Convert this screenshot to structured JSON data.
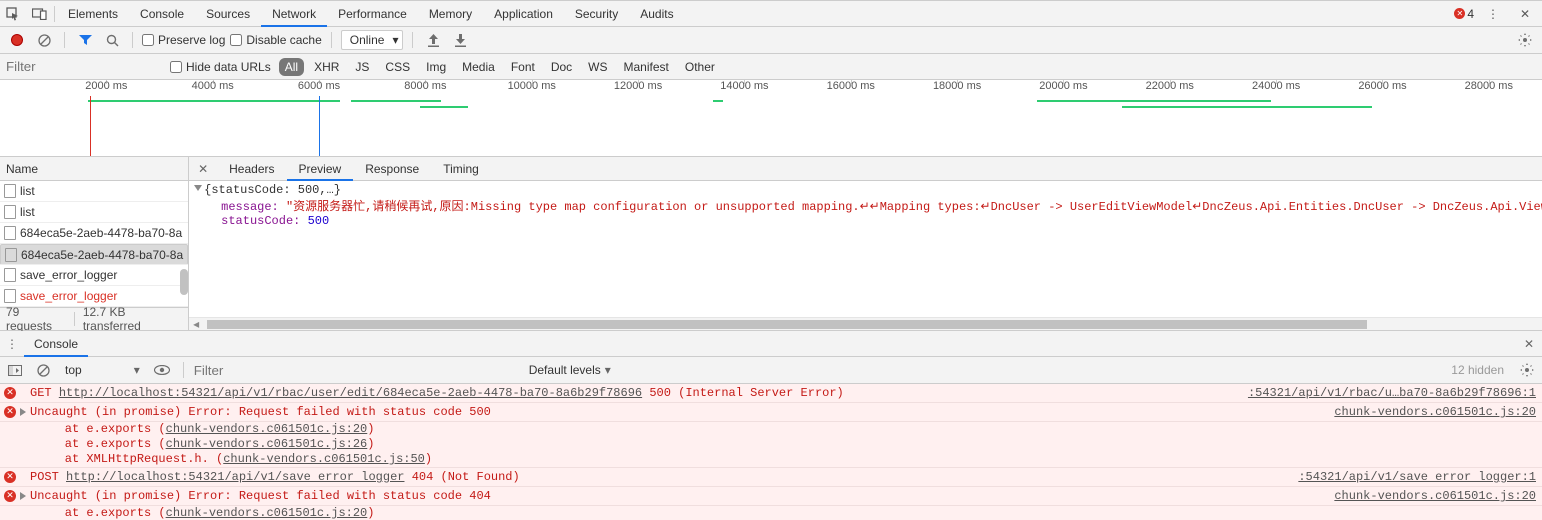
{
  "tabs": {
    "items": [
      "Elements",
      "Console",
      "Sources",
      "Network",
      "Performance",
      "Memory",
      "Application",
      "Security",
      "Audits"
    ],
    "active": "Network",
    "error_count": "4"
  },
  "toolbar": {
    "preserve_log": "Preserve log",
    "disable_cache": "Disable cache",
    "throttling": "Online"
  },
  "filter": {
    "placeholder": "Filter",
    "hide_data_urls": "Hide data URLs",
    "types": [
      "All",
      "XHR",
      "JS",
      "CSS",
      "Img",
      "Media",
      "Font",
      "Doc",
      "WS",
      "Manifest",
      "Other"
    ],
    "active_type": "All"
  },
  "timeline": {
    "labels": [
      "2000 ms",
      "4000 ms",
      "6000 ms",
      "8000 ms",
      "10000 ms",
      "12000 ms",
      "14000 ms",
      "16000 ms",
      "18000 ms",
      "20000 ms",
      "22000 ms",
      "24000 ms",
      "26000 ms",
      "28000 ms"
    ],
    "cursor_ms": 6000,
    "redline_ms": 1700,
    "bars": [
      {
        "from": 1650,
        "to": 6400,
        "row": 0
      },
      {
        "from": 6600,
        "to": 8300,
        "row": 0
      },
      {
        "from": 7900,
        "to": 8800,
        "row": 1
      },
      {
        "from": 13400,
        "to": 13600,
        "row": 0
      },
      {
        "from": 19500,
        "to": 23900,
        "row": 0
      },
      {
        "from": 21100,
        "to": 25800,
        "row": 1
      }
    ]
  },
  "requests": {
    "header": "Name",
    "items": [
      {
        "name": "list",
        "err": false,
        "sel": false
      },
      {
        "name": "list",
        "err": false,
        "sel": false
      },
      {
        "name": "684eca5e-2aeb-4478-ba70-8a",
        "err": false,
        "sel": false
      },
      {
        "name": "684eca5e-2aeb-4478-ba70-8a",
        "err": false,
        "sel": true
      },
      {
        "name": "save_error_logger",
        "err": false,
        "sel": false
      },
      {
        "name": "save_error_logger",
        "err": true,
        "sel": false
      }
    ],
    "status": {
      "count": "79 requests",
      "transfer": "12.7 KB transferred"
    }
  },
  "detail": {
    "tabs": [
      "Headers",
      "Preview",
      "Response",
      "Timing"
    ],
    "active": "Preview",
    "summary": "{statusCode: 500,…}",
    "message_key": "message:",
    "message_val": "\"资源服务器忙,请稍候再试,原因:Missing type map configuration or unsupported mapping.↵↵Mapping types:↵DncUser -> UserEditViewModel↵DncZeus.Api.Entities.DncUser -> DncZeus.Api.ViewModels.Rbac.DncUs",
    "status_key": "statusCode:",
    "status_val": "500"
  },
  "drawer": {
    "tab": "Console",
    "context": "top",
    "filter_placeholder": "Filter",
    "levels": "Default levels",
    "hidden": "12 hidden"
  },
  "console": [
    {
      "type": "err",
      "tri": false,
      "method": "GET",
      "url": "http://localhost:54321/api/v1/rbac/user/edit/684eca5e-2aeb-4478-ba70-8a6b29f78696",
      "status": "500 (Internal Server Error)",
      "src": ":54321/api/v1/rbac/u…ba70-8a6b29f78696:1"
    },
    {
      "type": "stackhead",
      "tri": true,
      "msg": "Uncaught (in promise) Error: Request failed with status code 500",
      "src": "chunk-vendors.c061501c.js:20"
    },
    {
      "type": "stack",
      "lines": [
        {
          "pre": "at e.exports (",
          "file": "chunk-vendors.c061501c.js:20",
          "post": ")"
        },
        {
          "pre": "at e.exports (",
          "file": "chunk-vendors.c061501c.js:26",
          "post": ")"
        },
        {
          "pre": "at XMLHttpRequest.h.<computed> (",
          "file": "chunk-vendors.c061501c.js:50",
          "post": ")"
        }
      ]
    },
    {
      "type": "err",
      "tri": false,
      "method": "POST",
      "url": "http://localhost:54321/api/v1/save error logger",
      "status": "404 (Not Found)",
      "src": ":54321/api/v1/save error logger:1"
    },
    {
      "type": "stackhead",
      "tri": true,
      "msg": "Uncaught (in promise) Error: Request failed with status code 404",
      "src": "chunk-vendors.c061501c.js:20"
    },
    {
      "type": "stack",
      "lines": [
        {
          "pre": "at e.exports (",
          "file": "chunk-vendors.c061501c.js:20",
          "post": ")"
        }
      ]
    }
  ]
}
